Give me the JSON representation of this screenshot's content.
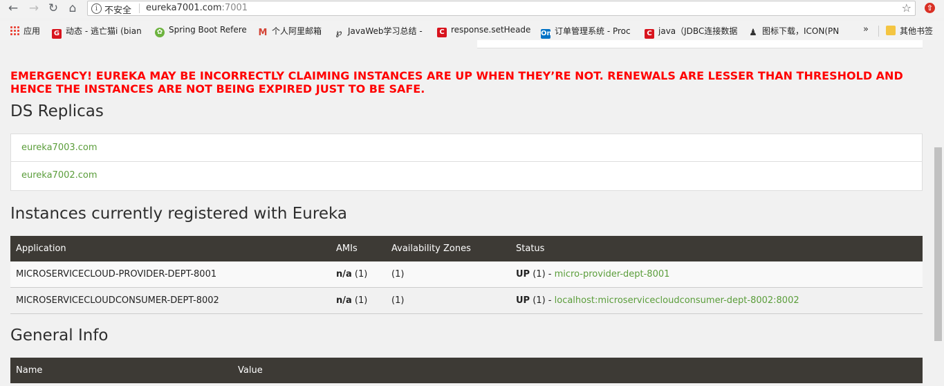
{
  "browser": {
    "security_label": "不安全",
    "url_host": "eureka7001.com",
    "url_port": ":7001"
  },
  "bookmarks": [
    {
      "label": "应用",
      "icon": "apps-icon"
    },
    {
      "label": "动态 - 逃亡猫i (bian",
      "icon": "csdn-icon"
    },
    {
      "label": "Spring Boot Refere",
      "icon": "spring-icon"
    },
    {
      "label": "个人阿里邮箱",
      "icon": "mail-icon"
    },
    {
      "label": "JavaWeb学习总结 -",
      "icon": "javaweb-icon"
    },
    {
      "label": "response.setHeade",
      "icon": "csdn-icon"
    },
    {
      "label": "订单管理系统 - Proc",
      "icon": "processon-icon"
    },
    {
      "label": "java（JDBC连接数据",
      "icon": "csdn-icon"
    },
    {
      "label": "图标下载，ICON(PN",
      "icon": "easyicon-icon"
    }
  ],
  "bookmarks_other": "其他书签",
  "emergency": "EMERGENCY! EUREKA MAY BE INCORRECTLY CLAIMING INSTANCES ARE UP WHEN THEY’RE NOT. RENEWALS ARE LESSER THAN THRESHOLD AND HENCE THE INSTANCES ARE NOT BEING EXPIRED JUST TO BE SAFE.",
  "ds_replicas": {
    "title": "DS Replicas",
    "items": [
      "eureka7003.com",
      "eureka7002.com"
    ]
  },
  "instances": {
    "title": "Instances currently registered with Eureka",
    "headers": [
      "Application",
      "AMIs",
      "Availability Zones",
      "Status"
    ],
    "rows": [
      {
        "app": "MICROSERVICECLOUD-PROVIDER-DEPT-8001",
        "ami": "n/a",
        "ami_count": "(1)",
        "zones": "(1)",
        "status": "UP",
        "status_count": "(1) -",
        "link": "micro-provider-dept-8001"
      },
      {
        "app": "MICROSERVICECLOUDCONSUMER-DEPT-8002",
        "ami": "n/a",
        "ami_count": "(1)",
        "zones": "(1)",
        "status": "UP",
        "status_count": "(1) -",
        "link": "localhost:microservicecloudconsumer-dept-8002:8002"
      }
    ]
  },
  "general_info": {
    "title": "General Info",
    "headers": [
      "Name",
      "Value"
    ]
  }
}
